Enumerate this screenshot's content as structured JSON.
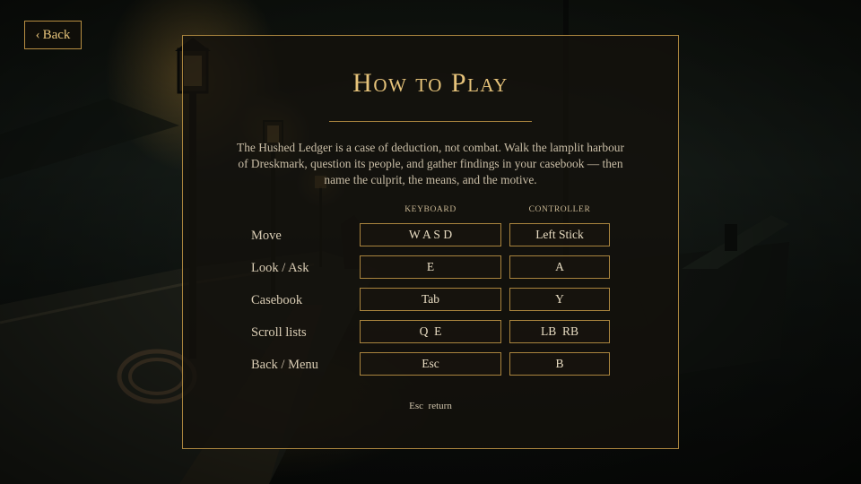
{
  "back_button": {
    "label": "Back",
    "icon": "chevron-left-icon"
  },
  "title": "How to Play",
  "intro": "The Hushed Ledger is a case of deduction, not combat. Walk the lamplit harbour of Dreskmark, question its people, and gather findings in your casebook — then name the culprit, the means, and the motive.",
  "columns": {
    "keyboard": "KEYBOARD",
    "controller": "CONTROLLER"
  },
  "controls": [
    {
      "action": "Move",
      "keyboard": "W A S D",
      "controller": "Left Stick"
    },
    {
      "action": "Look / Ask",
      "keyboard": "E",
      "controller": "A"
    },
    {
      "action": "Casebook",
      "keyboard": "Tab",
      "controller": "Y"
    },
    {
      "action": "Scroll lists",
      "keyboard": "Q  E",
      "controller": "LB  RB"
    },
    {
      "action": "Back / Menu",
      "keyboard": "Esc",
      "controller": "B"
    }
  ],
  "footer_hint": "Esc  return",
  "colors": {
    "accent": "#e6c37a",
    "border": "#a9843e",
    "panel": "#14110c"
  }
}
